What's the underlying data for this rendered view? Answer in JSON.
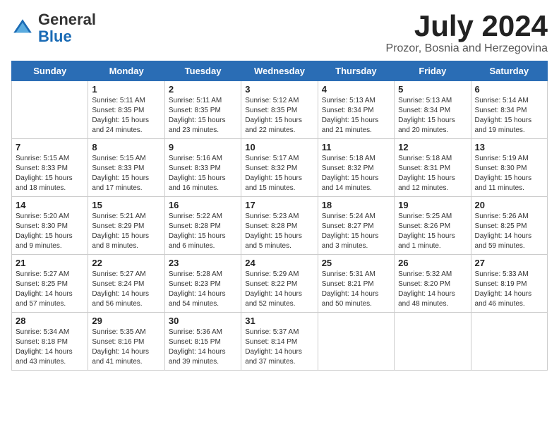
{
  "header": {
    "logo_general": "General",
    "logo_blue": "Blue",
    "month_title": "July 2024",
    "location": "Prozor, Bosnia and Herzegovina"
  },
  "days_of_week": [
    "Sunday",
    "Monday",
    "Tuesday",
    "Wednesday",
    "Thursday",
    "Friday",
    "Saturday"
  ],
  "weeks": [
    [
      {
        "day": "",
        "info": ""
      },
      {
        "day": "1",
        "info": "Sunrise: 5:11 AM\nSunset: 8:35 PM\nDaylight: 15 hours\nand 24 minutes."
      },
      {
        "day": "2",
        "info": "Sunrise: 5:11 AM\nSunset: 8:35 PM\nDaylight: 15 hours\nand 23 minutes."
      },
      {
        "day": "3",
        "info": "Sunrise: 5:12 AM\nSunset: 8:35 PM\nDaylight: 15 hours\nand 22 minutes."
      },
      {
        "day": "4",
        "info": "Sunrise: 5:13 AM\nSunset: 8:34 PM\nDaylight: 15 hours\nand 21 minutes."
      },
      {
        "day": "5",
        "info": "Sunrise: 5:13 AM\nSunset: 8:34 PM\nDaylight: 15 hours\nand 20 minutes."
      },
      {
        "day": "6",
        "info": "Sunrise: 5:14 AM\nSunset: 8:34 PM\nDaylight: 15 hours\nand 19 minutes."
      }
    ],
    [
      {
        "day": "7",
        "info": "Sunrise: 5:15 AM\nSunset: 8:33 PM\nDaylight: 15 hours\nand 18 minutes."
      },
      {
        "day": "8",
        "info": "Sunrise: 5:15 AM\nSunset: 8:33 PM\nDaylight: 15 hours\nand 17 minutes."
      },
      {
        "day": "9",
        "info": "Sunrise: 5:16 AM\nSunset: 8:33 PM\nDaylight: 15 hours\nand 16 minutes."
      },
      {
        "day": "10",
        "info": "Sunrise: 5:17 AM\nSunset: 8:32 PM\nDaylight: 15 hours\nand 15 minutes."
      },
      {
        "day": "11",
        "info": "Sunrise: 5:18 AM\nSunset: 8:32 PM\nDaylight: 15 hours\nand 14 minutes."
      },
      {
        "day": "12",
        "info": "Sunrise: 5:18 AM\nSunset: 8:31 PM\nDaylight: 15 hours\nand 12 minutes."
      },
      {
        "day": "13",
        "info": "Sunrise: 5:19 AM\nSunset: 8:30 PM\nDaylight: 15 hours\nand 11 minutes."
      }
    ],
    [
      {
        "day": "14",
        "info": "Sunrise: 5:20 AM\nSunset: 8:30 PM\nDaylight: 15 hours\nand 9 minutes."
      },
      {
        "day": "15",
        "info": "Sunrise: 5:21 AM\nSunset: 8:29 PM\nDaylight: 15 hours\nand 8 minutes."
      },
      {
        "day": "16",
        "info": "Sunrise: 5:22 AM\nSunset: 8:28 PM\nDaylight: 15 hours\nand 6 minutes."
      },
      {
        "day": "17",
        "info": "Sunrise: 5:23 AM\nSunset: 8:28 PM\nDaylight: 15 hours\nand 5 minutes."
      },
      {
        "day": "18",
        "info": "Sunrise: 5:24 AM\nSunset: 8:27 PM\nDaylight: 15 hours\nand 3 minutes."
      },
      {
        "day": "19",
        "info": "Sunrise: 5:25 AM\nSunset: 8:26 PM\nDaylight: 15 hours\nand 1 minute."
      },
      {
        "day": "20",
        "info": "Sunrise: 5:26 AM\nSunset: 8:25 PM\nDaylight: 14 hours\nand 59 minutes."
      }
    ],
    [
      {
        "day": "21",
        "info": "Sunrise: 5:27 AM\nSunset: 8:25 PM\nDaylight: 14 hours\nand 57 minutes."
      },
      {
        "day": "22",
        "info": "Sunrise: 5:27 AM\nSunset: 8:24 PM\nDaylight: 14 hours\nand 56 minutes."
      },
      {
        "day": "23",
        "info": "Sunrise: 5:28 AM\nSunset: 8:23 PM\nDaylight: 14 hours\nand 54 minutes."
      },
      {
        "day": "24",
        "info": "Sunrise: 5:29 AM\nSunset: 8:22 PM\nDaylight: 14 hours\nand 52 minutes."
      },
      {
        "day": "25",
        "info": "Sunrise: 5:31 AM\nSunset: 8:21 PM\nDaylight: 14 hours\nand 50 minutes."
      },
      {
        "day": "26",
        "info": "Sunrise: 5:32 AM\nSunset: 8:20 PM\nDaylight: 14 hours\nand 48 minutes."
      },
      {
        "day": "27",
        "info": "Sunrise: 5:33 AM\nSunset: 8:19 PM\nDaylight: 14 hours\nand 46 minutes."
      }
    ],
    [
      {
        "day": "28",
        "info": "Sunrise: 5:34 AM\nSunset: 8:18 PM\nDaylight: 14 hours\nand 43 minutes."
      },
      {
        "day": "29",
        "info": "Sunrise: 5:35 AM\nSunset: 8:16 PM\nDaylight: 14 hours\nand 41 minutes."
      },
      {
        "day": "30",
        "info": "Sunrise: 5:36 AM\nSunset: 8:15 PM\nDaylight: 14 hours\nand 39 minutes."
      },
      {
        "day": "31",
        "info": "Sunrise: 5:37 AM\nSunset: 8:14 PM\nDaylight: 14 hours\nand 37 minutes."
      },
      {
        "day": "",
        "info": ""
      },
      {
        "day": "",
        "info": ""
      },
      {
        "day": "",
        "info": ""
      }
    ]
  ]
}
